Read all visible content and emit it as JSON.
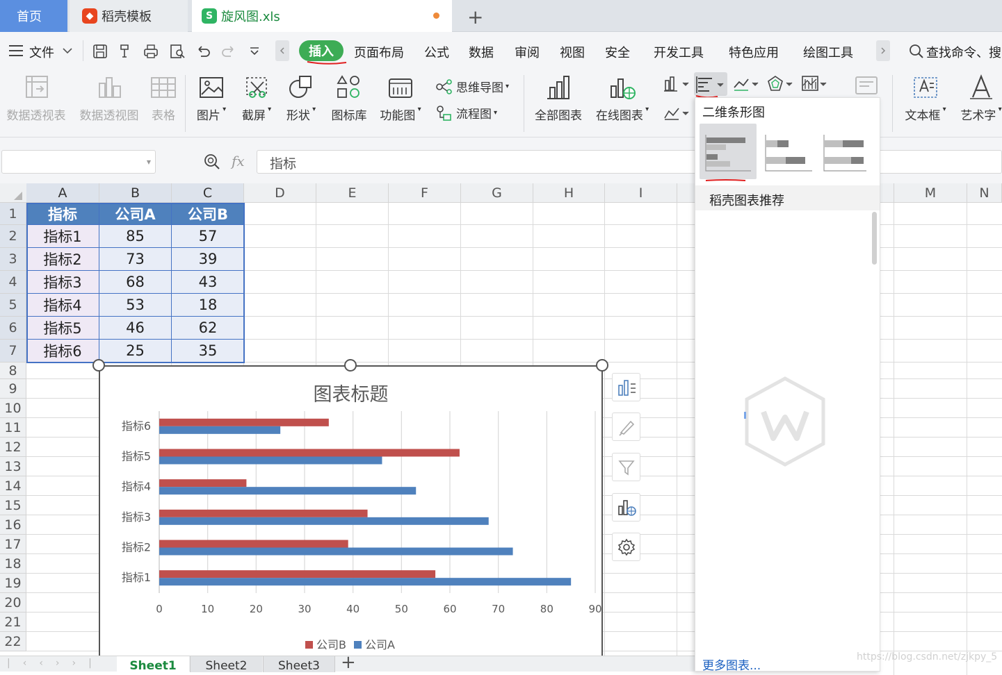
{
  "tabs": {
    "home": "首页",
    "template": "稻壳模板",
    "file": "旋风图.xls",
    "add": "+"
  },
  "menu": {
    "file": "文件",
    "items": [
      "插入",
      "页面布局",
      "公式",
      "数据",
      "审阅",
      "视图",
      "安全",
      "开发工具",
      "特色应用",
      "绘图工具"
    ],
    "search": "查找命令、搜"
  },
  "ribbon": {
    "pivot_table": "数据透视表",
    "pivot_chart": "数据透视图",
    "table": "表格",
    "picture": "图片",
    "screenshot": "截屏",
    "shape": "形状",
    "icon_lib": "图标库",
    "func_chart": "功能图",
    "mindmap": "思维导图",
    "flowchart": "流程图",
    "all_charts": "全部图表",
    "online_charts": "在线图表",
    "textbox": "文本框",
    "wordart": "艺术字"
  },
  "formula": {
    "fx": "fx",
    "value": "指标"
  },
  "columns": [
    "A",
    "B",
    "C",
    "D",
    "E",
    "F",
    "G",
    "H",
    "I",
    "M",
    "N"
  ],
  "rows": [
    "1",
    "2",
    "3",
    "4",
    "5",
    "6",
    "7",
    "8",
    "9",
    "10",
    "11",
    "12",
    "13",
    "14",
    "15",
    "16",
    "17",
    "18",
    "19",
    "20",
    "21",
    "22"
  ],
  "table": {
    "headers": [
      "指标",
      "公司A",
      "公司B"
    ],
    "rows": [
      [
        "指标1",
        "85",
        "57"
      ],
      [
        "指标2",
        "73",
        "39"
      ],
      [
        "指标3",
        "68",
        "43"
      ],
      [
        "指标4",
        "53",
        "18"
      ],
      [
        "指标5",
        "46",
        "62"
      ],
      [
        "指标6",
        "25",
        "35"
      ]
    ]
  },
  "chart_data": {
    "type": "bar",
    "orientation": "horizontal",
    "title": "图表标题",
    "categories": [
      "指标1",
      "指标2",
      "指标3",
      "指标4",
      "指标5",
      "指标6"
    ],
    "series": [
      {
        "name": "公司B",
        "values": [
          57,
          39,
          43,
          18,
          62,
          35
        ],
        "color": "#c0504d"
      },
      {
        "name": "公司A",
        "values": [
          85,
          73,
          68,
          53,
          46,
          25
        ],
        "color": "#4f81bd"
      }
    ],
    "xlim": [
      0,
      90
    ],
    "xticks": [
      "0",
      "10",
      "20",
      "30",
      "40",
      "50",
      "60",
      "70",
      "80",
      "90"
    ],
    "grid": true,
    "legend": "bottom"
  },
  "dropdown": {
    "section_title": "二维条形图",
    "recommend": "稻壳图表推荐",
    "more": "更多图表..."
  },
  "sheets": [
    "Sheet1",
    "Sheet2",
    "Sheet3"
  ],
  "watermark": "https://blog.csdn.net/zjkpy_5"
}
